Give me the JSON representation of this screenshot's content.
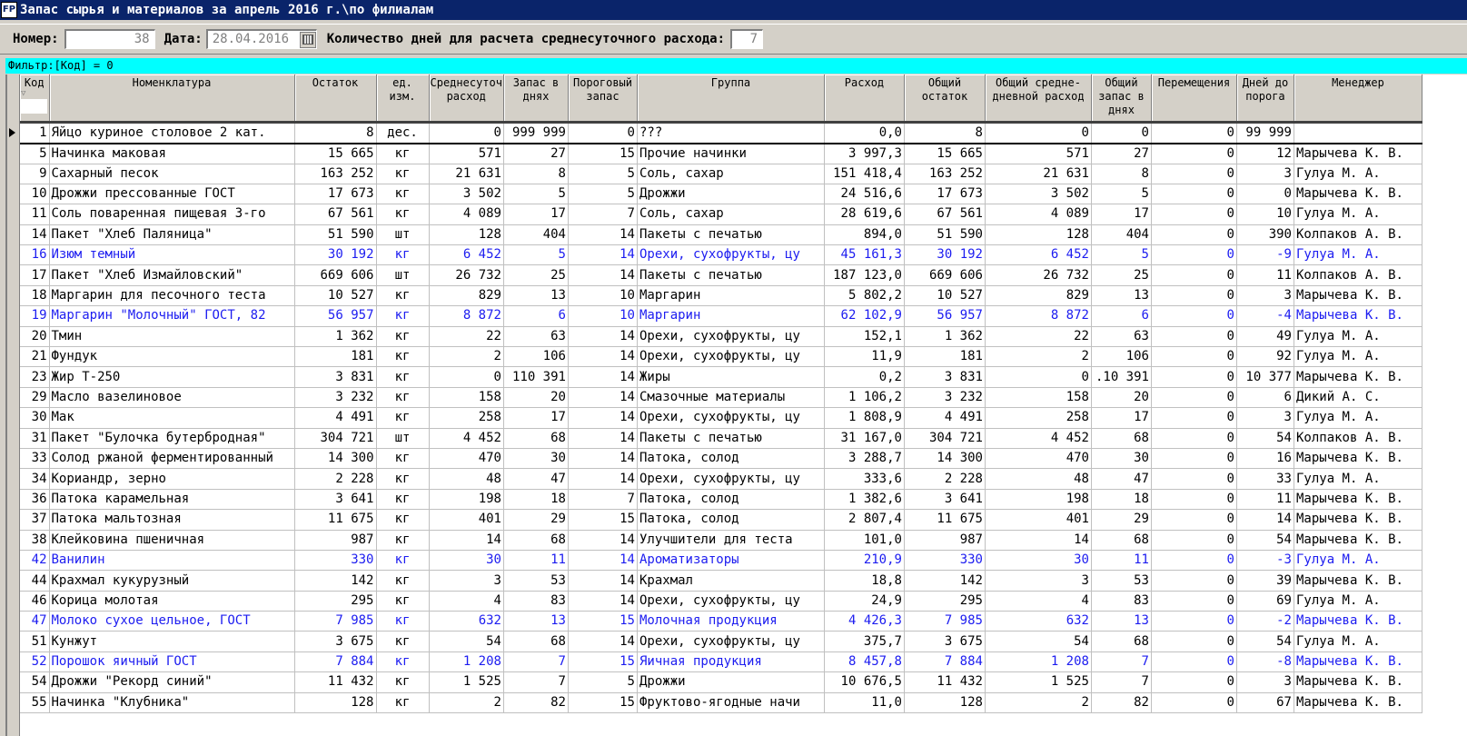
{
  "window": {
    "title": "Запас сырья и материалов за апрель 2016 г.\\по филиалам",
    "icon": "app-icon"
  },
  "params": {
    "number_label": "Номер:",
    "number_value": "38",
    "date_label": "Дата:",
    "date_value": "28.04.2016",
    "days_label": "Количество дней для расчета среднесуточного расхода:",
    "days_value": "7"
  },
  "filter": {
    "text": "Фильтр:[Код] = 0"
  },
  "colors": {
    "titlebar": "#0a246a",
    "filter": "#00ffff",
    "highlight_row": "#1c1cf0"
  },
  "columns": [
    "Код",
    "Номенклатура",
    "Остаток",
    "ед. изм.",
    "Среднесуточ расход",
    "Запас в днях",
    "Пороговый запас",
    "Группа",
    "Расход",
    "Общий остаток",
    "Общий средне-дневной расход",
    "Общий запас в днях",
    "Перемещения",
    "Дней до порога",
    "Менеджер"
  ],
  "rows": [
    {
      "code": "1",
      "name": "Яйцо куриное столовое 2 кат.",
      "stock": "8",
      "unit": "дес.",
      "avg": "0",
      "days": "999 999",
      "threshold": "0",
      "group": "???",
      "consumption": "0,0",
      "total_stock": "8",
      "total_avg": "0",
      "total_days": "0",
      "moves": "0",
      "days_to": "99 999",
      "manager": "",
      "blue": false
    },
    {
      "code": "5",
      "name": "Начинка маковая",
      "stock": "15 665",
      "unit": "кг",
      "avg": "571",
      "days": "27",
      "threshold": "15",
      "group": "Прочие начинки",
      "consumption": "3 997,3",
      "total_stock": "15 665",
      "total_avg": "571",
      "total_days": "27",
      "moves": "0",
      "days_to": "12",
      "manager": "Марычева К. В.",
      "blue": false
    },
    {
      "code": "9",
      "name": "Сахарный песок",
      "stock": "163 252",
      "unit": "кг",
      "avg": "21 631",
      "days": "8",
      "threshold": "5",
      "group": "Соль, сахар",
      "consumption": "151 418,4",
      "total_stock": "163 252",
      "total_avg": "21 631",
      "total_days": "8",
      "moves": "0",
      "days_to": "3",
      "manager": "Гулуа М. А.",
      "blue": false
    },
    {
      "code": "10",
      "name": "Дрожжи прессованные ГОСТ",
      "stock": "17 673",
      "unit": "кг",
      "avg": "3 502",
      "days": "5",
      "threshold": "5",
      "group": "Дрожжи",
      "consumption": "24 516,6",
      "total_stock": "17 673",
      "total_avg": "3 502",
      "total_days": "5",
      "moves": "0",
      "days_to": "0",
      "manager": "Марычева К. В.",
      "blue": false
    },
    {
      "code": "11",
      "name": "Соль поваренная пищевая 3-го",
      "stock": "67 561",
      "unit": "кг",
      "avg": "4 089",
      "days": "17",
      "threshold": "7",
      "group": "Соль, сахар",
      "consumption": "28 619,6",
      "total_stock": "67 561",
      "total_avg": "4 089",
      "total_days": "17",
      "moves": "0",
      "days_to": "10",
      "manager": "Гулуа М. А.",
      "blue": false
    },
    {
      "code": "14",
      "name": "Пакет \"Хлеб Паляница\"",
      "stock": "51 590",
      "unit": "шт",
      "avg": "128",
      "days": "404",
      "threshold": "14",
      "group": "Пакеты с печатью",
      "consumption": "894,0",
      "total_stock": "51 590",
      "total_avg": "128",
      "total_days": "404",
      "moves": "0",
      "days_to": "390",
      "manager": "Колпаков А. В.",
      "blue": false
    },
    {
      "code": "16",
      "name": "Изюм темный",
      "stock": "30 192",
      "unit": "кг",
      "avg": "6 452",
      "days": "5",
      "threshold": "14",
      "group": "Орехи, сухофрукты, цу",
      "consumption": "45 161,3",
      "total_stock": "30 192",
      "total_avg": "6 452",
      "total_days": "5",
      "moves": "0",
      "days_to": "-9",
      "manager": "Гулуа М. А.",
      "blue": true
    },
    {
      "code": "17",
      "name": "Пакет \"Хлеб Измайловский\"",
      "stock": "669 606",
      "unit": "шт",
      "avg": "26 732",
      "days": "25",
      "threshold": "14",
      "group": "Пакеты с печатью",
      "consumption": "187 123,0",
      "total_stock": "669 606",
      "total_avg": "26 732",
      "total_days": "25",
      "moves": "0",
      "days_to": "11",
      "manager": "Колпаков А. В.",
      "blue": false
    },
    {
      "code": "18",
      "name": "Маргарин для песочного теста",
      "stock": "10 527",
      "unit": "кг",
      "avg": "829",
      "days": "13",
      "threshold": "10",
      "group": "Маргарин",
      "consumption": "5 802,2",
      "total_stock": "10 527",
      "total_avg": "829",
      "total_days": "13",
      "moves": "0",
      "days_to": "3",
      "manager": "Марычева К. В.",
      "blue": false
    },
    {
      "code": "19",
      "name": "Маргарин \"Молочный\" ГОСТ, 82",
      "stock": "56 957",
      "unit": "кг",
      "avg": "8 872",
      "days": "6",
      "threshold": "10",
      "group": "Маргарин",
      "consumption": "62 102,9",
      "total_stock": "56 957",
      "total_avg": "8 872",
      "total_days": "6",
      "moves": "0",
      "days_to": "-4",
      "manager": "Марычева К. В.",
      "blue": true
    },
    {
      "code": "20",
      "name": "Тмин",
      "stock": "1 362",
      "unit": "кг",
      "avg": "22",
      "days": "63",
      "threshold": "14",
      "group": "Орехи, сухофрукты, цу",
      "consumption": "152,1",
      "total_stock": "1 362",
      "total_avg": "22",
      "total_days": "63",
      "moves": "0",
      "days_to": "49",
      "manager": "Гулуа М. А.",
      "blue": false
    },
    {
      "code": "21",
      "name": "Фундук",
      "stock": "181",
      "unit": "кг",
      "avg": "2",
      "days": "106",
      "threshold": "14",
      "group": "Орехи, сухофрукты, цу",
      "consumption": "11,9",
      "total_stock": "181",
      "total_avg": "2",
      "total_days": "106",
      "moves": "0",
      "days_to": "92",
      "manager": "Гулуа М. А.",
      "blue": false
    },
    {
      "code": "23",
      "name": "Жир Т-250",
      "stock": "3 831",
      "unit": "кг",
      "avg": "0",
      "days": "110 391",
      "threshold": "14",
      "group": "Жиры",
      "consumption": "0,2",
      "total_stock": "3 831",
      "total_avg": "0",
      "total_days": ".10 391",
      "moves": "0",
      "days_to": "10 377",
      "manager": "Марычева К. В.",
      "blue": false
    },
    {
      "code": "29",
      "name": "Масло вазелиновое",
      "stock": "3 232",
      "unit": "кг",
      "avg": "158",
      "days": "20",
      "threshold": "14",
      "group": "Смазочные материалы",
      "consumption": "1 106,2",
      "total_stock": "3 232",
      "total_avg": "158",
      "total_days": "20",
      "moves": "0",
      "days_to": "6",
      "manager": "Дикий А. С.",
      "blue": false
    },
    {
      "code": "30",
      "name": "Мак",
      "stock": "4 491",
      "unit": "кг",
      "avg": "258",
      "days": "17",
      "threshold": "14",
      "group": "Орехи, сухофрукты, цу",
      "consumption": "1 808,9",
      "total_stock": "4 491",
      "total_avg": "258",
      "total_days": "17",
      "moves": "0",
      "days_to": "3",
      "manager": "Гулуа М. А.",
      "blue": false
    },
    {
      "code": "31",
      "name": "Пакет \"Булочка бутербродная\"",
      "stock": "304 721",
      "unit": "шт",
      "avg": "4 452",
      "days": "68",
      "threshold": "14",
      "group": "Пакеты с печатью",
      "consumption": "31 167,0",
      "total_stock": "304 721",
      "total_avg": "4 452",
      "total_days": "68",
      "moves": "0",
      "days_to": "54",
      "manager": "Колпаков А. В.",
      "blue": false
    },
    {
      "code": "33",
      "name": "Солод ржаной ферментированный",
      "stock": "14 300",
      "unit": "кг",
      "avg": "470",
      "days": "30",
      "threshold": "14",
      "group": "Патока, солод",
      "consumption": "3 288,7",
      "total_stock": "14 300",
      "total_avg": "470",
      "total_days": "30",
      "moves": "0",
      "days_to": "16",
      "manager": "Марычева К. В.",
      "blue": false
    },
    {
      "code": "34",
      "name": "Кориандр, зерно",
      "stock": "2 228",
      "unit": "кг",
      "avg": "48",
      "days": "47",
      "threshold": "14",
      "group": "Орехи, сухофрукты, цу",
      "consumption": "333,6",
      "total_stock": "2 228",
      "total_avg": "48",
      "total_days": "47",
      "moves": "0",
      "days_to": "33",
      "manager": "Гулуа М. А.",
      "blue": false
    },
    {
      "code": "36",
      "name": "Патока карамельная",
      "stock": "3 641",
      "unit": "кг",
      "avg": "198",
      "days": "18",
      "threshold": "7",
      "group": "Патока, солод",
      "consumption": "1 382,6",
      "total_stock": "3 641",
      "total_avg": "198",
      "total_days": "18",
      "moves": "0",
      "days_to": "11",
      "manager": "Марычева К. В.",
      "blue": false
    },
    {
      "code": "37",
      "name": "Патока мальтозная",
      "stock": "11 675",
      "unit": "кг",
      "avg": "401",
      "days": "29",
      "threshold": "15",
      "group": "Патока, солод",
      "consumption": "2 807,4",
      "total_stock": "11 675",
      "total_avg": "401",
      "total_days": "29",
      "moves": "0",
      "days_to": "14",
      "manager": "Марычева К. В.",
      "blue": false
    },
    {
      "code": "38",
      "name": "Клейковина пшеничная",
      "stock": "987",
      "unit": "кг",
      "avg": "14",
      "days": "68",
      "threshold": "14",
      "group": "Улучшители для теста",
      "consumption": "101,0",
      "total_stock": "987",
      "total_avg": "14",
      "total_days": "68",
      "moves": "0",
      "days_to": "54",
      "manager": "Марычева К. В.",
      "blue": false
    },
    {
      "code": "42",
      "name": "Ванилин",
      "stock": "330",
      "unit": "кг",
      "avg": "30",
      "days": "11",
      "threshold": "14",
      "group": "Ароматизаторы",
      "consumption": "210,9",
      "total_stock": "330",
      "total_avg": "30",
      "total_days": "11",
      "moves": "0",
      "days_to": "-3",
      "manager": "Гулуа М. А.",
      "blue": true
    },
    {
      "code": "44",
      "name": "Крахмал кукурузный",
      "stock": "142",
      "unit": "кг",
      "avg": "3",
      "days": "53",
      "threshold": "14",
      "group": "Крахмал",
      "consumption": "18,8",
      "total_stock": "142",
      "total_avg": "3",
      "total_days": "53",
      "moves": "0",
      "days_to": "39",
      "manager": "Марычева К. В.",
      "blue": false
    },
    {
      "code": "46",
      "name": "Корица молотая",
      "stock": "295",
      "unit": "кг",
      "avg": "4",
      "days": "83",
      "threshold": "14",
      "group": "Орехи, сухофрукты, цу",
      "consumption": "24,9",
      "total_stock": "295",
      "total_avg": "4",
      "total_days": "83",
      "moves": "0",
      "days_to": "69",
      "manager": "Гулуа М. А.",
      "blue": false
    },
    {
      "code": "47",
      "name": "Молоко сухое цельное, ГОСТ",
      "stock": "7 985",
      "unit": "кг",
      "avg": "632",
      "days": "13",
      "threshold": "15",
      "group": "Молочная продукция",
      "consumption": "4 426,3",
      "total_stock": "7 985",
      "total_avg": "632",
      "total_days": "13",
      "moves": "0",
      "days_to": "-2",
      "manager": "Марычева К. В.",
      "blue": true
    },
    {
      "code": "51",
      "name": "Кунжут",
      "stock": "3 675",
      "unit": "кг",
      "avg": "54",
      "days": "68",
      "threshold": "14",
      "group": "Орехи, сухофрукты, цу",
      "consumption": "375,7",
      "total_stock": "3 675",
      "total_avg": "54",
      "total_days": "68",
      "moves": "0",
      "days_to": "54",
      "manager": "Гулуа М. А.",
      "blue": false
    },
    {
      "code": "52",
      "name": "Порошок яичный ГОСТ",
      "stock": "7 884",
      "unit": "кг",
      "avg": "1 208",
      "days": "7",
      "threshold": "15",
      "group": "Яичная продукция",
      "consumption": "8 457,8",
      "total_stock": "7 884",
      "total_avg": "1 208",
      "total_days": "7",
      "moves": "0",
      "days_to": "-8",
      "manager": "Марычева К. В.",
      "blue": true
    },
    {
      "code": "54",
      "name": "Дрожжи \"Рекорд синий\"",
      "stock": "11 432",
      "unit": "кг",
      "avg": "1 525",
      "days": "7",
      "threshold": "5",
      "group": "Дрожжи",
      "consumption": "10 676,5",
      "total_stock": "11 432",
      "total_avg": "1 525",
      "total_days": "7",
      "moves": "0",
      "days_to": "3",
      "manager": "Марычева К. В.",
      "blue": false
    },
    {
      "code": "55",
      "name": "Начинка \"Клубника\"",
      "stock": "128",
      "unit": "кг",
      "avg": "2",
      "days": "82",
      "threshold": "15",
      "group": "Фруктово-ягодные начи",
      "consumption": "11,0",
      "total_stock": "128",
      "total_avg": "2",
      "total_days": "82",
      "moves": "0",
      "days_to": "67",
      "manager": "Марычева К. В.",
      "blue": false
    }
  ]
}
